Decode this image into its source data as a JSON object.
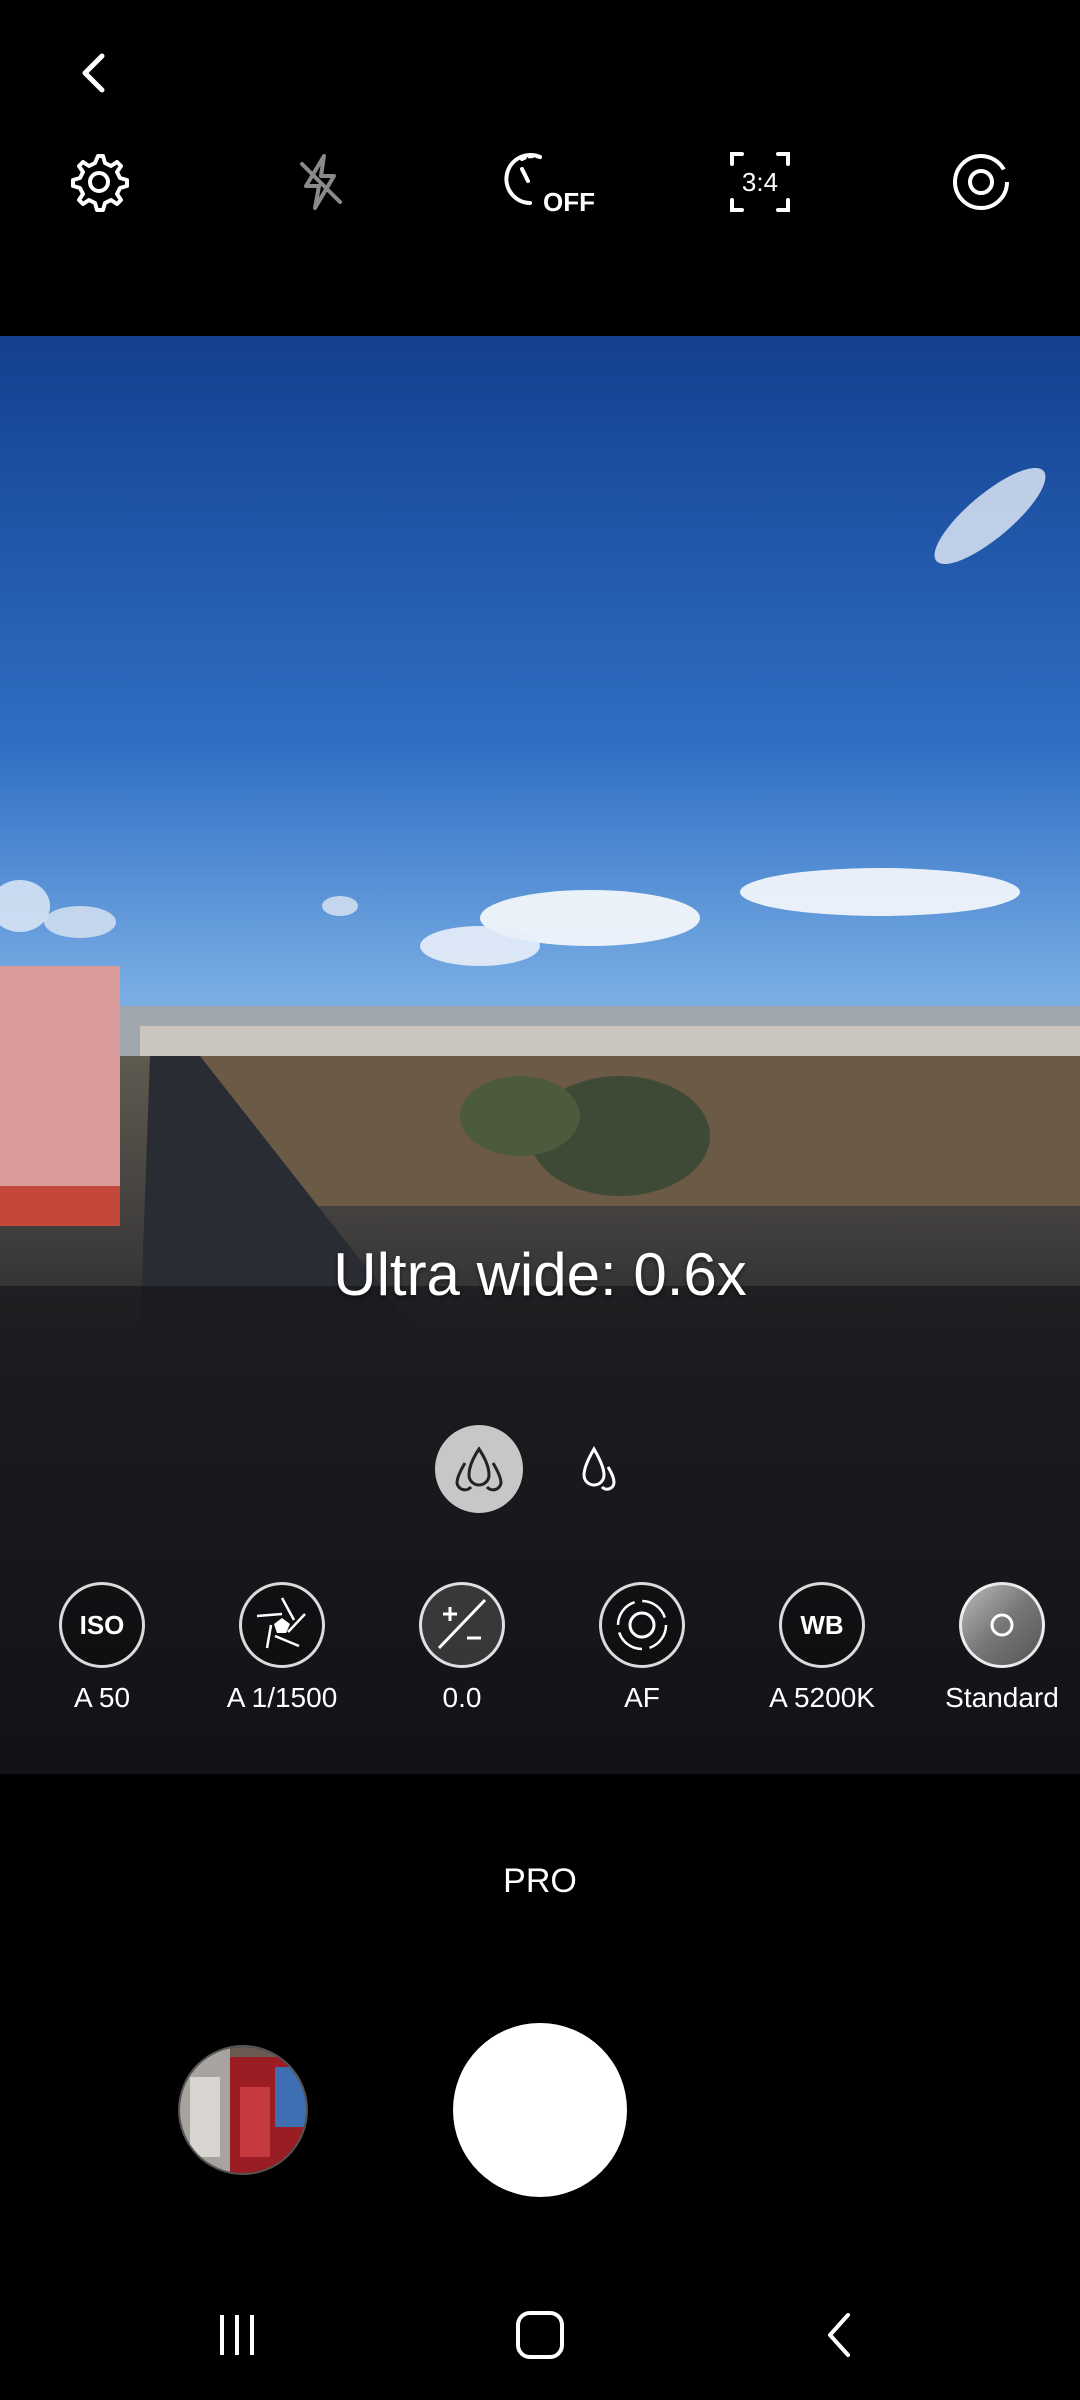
{
  "top_bar": {
    "back_icon": "chevron-left-icon",
    "icons": [
      "gear-icon",
      "flash-off-icon",
      "timer-off-icon",
      "aspect-ratio-icon",
      "motion-photo-icon"
    ],
    "timer_text": "OFF",
    "aspect_ratio_text": "3:4"
  },
  "viewfinder": {
    "zoom_label": "Ultra wide: 0.6x",
    "lens_buttons": [
      "ultra-wide-lens-icon",
      "wide-lens-icon"
    ]
  },
  "pro_controls": [
    {
      "name": "iso",
      "icon_text": "ISO",
      "value": "A 50"
    },
    {
      "name": "shutter-speed",
      "icon_text": "",
      "value": "A 1/1500"
    },
    {
      "name": "exposure",
      "icon_text": "",
      "value": "0.0"
    },
    {
      "name": "focus",
      "icon_text": "",
      "value": "AF"
    },
    {
      "name": "white-balance",
      "icon_text": "WB",
      "value": "A 5200K"
    },
    {
      "name": "color-tone",
      "icon_text": "",
      "value": "Standard"
    }
  ],
  "mode": {
    "label": "PRO"
  },
  "nav_bar": {
    "icons": [
      "recent-apps-icon",
      "home-icon",
      "back-icon"
    ]
  },
  "colors": {
    "sky_top": "#1b4a9c",
    "sky_bottom": "#4c8fdc",
    "background": "#000000",
    "accent": "#ffffff"
  }
}
